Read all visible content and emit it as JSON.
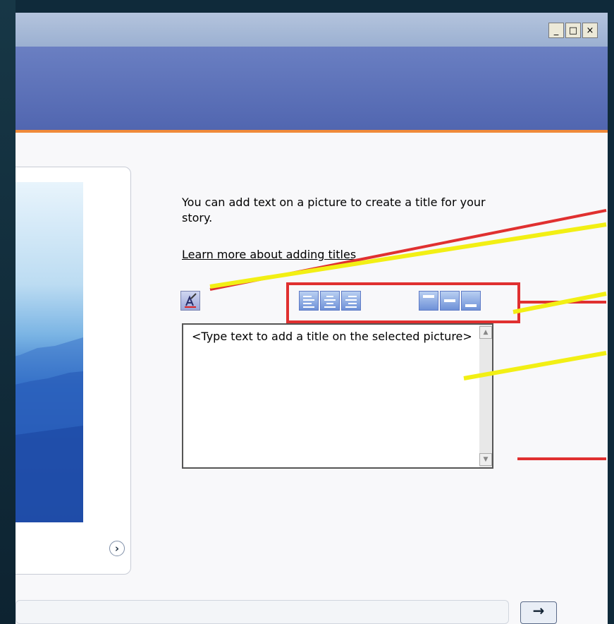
{
  "window": {
    "controls": {
      "minimize": "_",
      "maximize": "□",
      "close": "×"
    }
  },
  "content": {
    "description": "You can add text on a picture to create a title for your story.",
    "learn_more_link": "Learn more about adding titles",
    "title_textbox": {
      "placeholder": "<Type text to add a title on the selected picture>"
    },
    "toolbar": {
      "alignment_buttons": [
        "align-left-icon",
        "align-center-icon",
        "align-right-icon"
      ],
      "position_buttons": [
        "position-top-icon",
        "position-middle-icon",
        "position-bottom-icon"
      ]
    }
  },
  "nav": {
    "next_arrow": "›",
    "forward_arrow": "→"
  },
  "colors": {
    "header": "#5a6fb8",
    "accent_stripe": "#f08a3a",
    "callout_red": "#e03030",
    "callout_yellow": "#f2ef14"
  }
}
